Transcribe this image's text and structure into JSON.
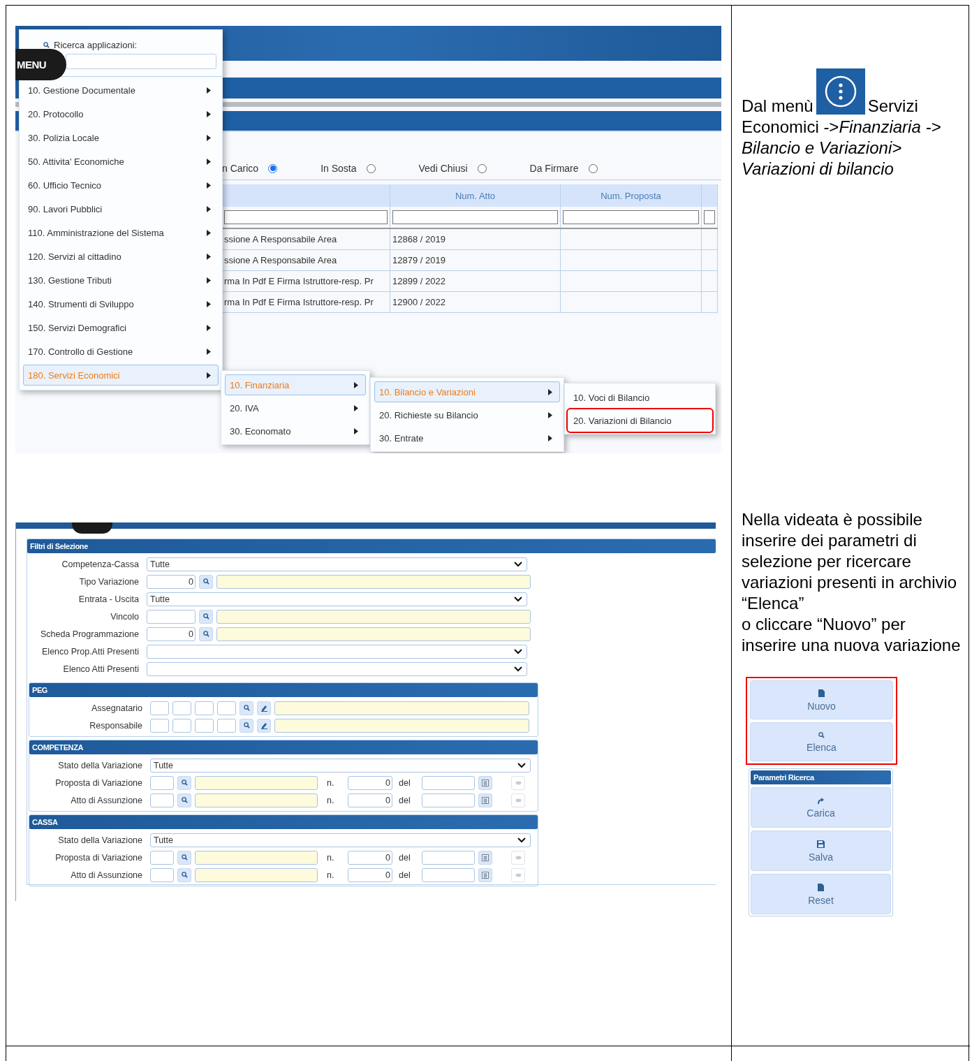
{
  "menu_screenshot": {
    "radios": [
      {
        "label": "n Carico",
        "selected": true
      },
      {
        "label": "In Sosta",
        "selected": false
      },
      {
        "label": "Vedi Chiusi",
        "selected": false
      },
      {
        "label": "Da Firmare",
        "selected": false
      }
    ],
    "table": {
      "columns": [
        "",
        "Num. Atto",
        "Num. Proposta"
      ],
      "rows": [
        [
          "ssione A Responsabile Area",
          "12868 / 2019"
        ],
        [
          "ssione A Responsabile Area",
          "12879 / 2019"
        ],
        [
          "rma In Pdf E Firma Istruttore-resp. Pr",
          "12899 / 2022"
        ],
        [
          "rma In Pdf E Firma Istruttore-resp. Pr",
          "12900 / 2022"
        ]
      ]
    },
    "menu": {
      "badge": "MENU",
      "search_label": "Ricerca applicazioni:",
      "items": [
        {
          "label": "10. Gestione Documentale",
          "selected": false
        },
        {
          "label": "20. Protocollo",
          "selected": false
        },
        {
          "label": "30. Polizia Locale",
          "selected": false
        },
        {
          "label": "50. Attivita' Economiche",
          "selected": false
        },
        {
          "label": "60. Ufficio Tecnico",
          "selected": false
        },
        {
          "label": "90. Lavori Pubblici",
          "selected": false
        },
        {
          "label": "110. Amministrazione del Sistema",
          "selected": false
        },
        {
          "label": "120. Servizi al cittadino",
          "selected": false
        },
        {
          "label": "130. Gestione Tributi",
          "selected": false
        },
        {
          "label": "140. Strumenti di Sviluppo",
          "selected": false
        },
        {
          "label": "150. Servizi Demografici",
          "selected": false
        },
        {
          "label": "170. Controllo di Gestione",
          "selected": false
        },
        {
          "label": "180. Servizi Economici",
          "selected": true
        }
      ]
    },
    "submenus": [
      {
        "items": [
          {
            "label": "10. Finanziaria",
            "selected": true,
            "submenu": true,
            "highlighted": false
          },
          {
            "label": "20. IVA",
            "selected": false,
            "submenu": true,
            "highlighted": false
          },
          {
            "label": "30. Economato",
            "selected": false,
            "submenu": true,
            "highlighted": false
          }
        ]
      },
      {
        "items": [
          {
            "label": "10. Bilancio e Variazioni",
            "selected": true,
            "submenu": true,
            "highlighted": false
          },
          {
            "label": "20. Richieste su Bilancio",
            "selected": false,
            "submenu": true,
            "highlighted": false
          },
          {
            "label": "30. Entrate",
            "selected": false,
            "submenu": true,
            "highlighted": false
          }
        ]
      },
      {
        "items": [
          {
            "label": "10. Voci di Bilancio",
            "selected": false,
            "submenu": false,
            "highlighted": false
          },
          {
            "label": "20. Variazioni di Bilancio",
            "selected": false,
            "submenu": false,
            "highlighted": true
          }
        ]
      }
    ]
  },
  "form_screenshot": {
    "title": "Filtri di Selezione",
    "rows": [
      {
        "label": "Competenza-Cassa",
        "kind": "select",
        "value": "Tutte"
      },
      {
        "label": "Tipo Variazione",
        "kind": "lookup",
        "value": "0"
      },
      {
        "label": "Entrata - Uscita",
        "kind": "select",
        "value": "Tutte"
      },
      {
        "label": "Vincolo",
        "kind": "lookup"
      },
      {
        "label": "Scheda Programmazione",
        "kind": "lookup",
        "value": "0"
      },
      {
        "label": "Elenco Prop.Atti Presenti",
        "kind": "select"
      },
      {
        "label": "Elenco Atti Presenti",
        "kind": "select"
      }
    ],
    "sections": [
      {
        "title": "PEG",
        "rows": [
          {
            "label": "Assegnatario",
            "kind": "peg"
          },
          {
            "label": "Responsabile",
            "kind": "peg"
          }
        ]
      },
      {
        "title": "COMPETENZA",
        "rows": [
          {
            "label": "Stato della Variazione",
            "kind": "select",
            "value": "Tutte"
          },
          {
            "label": "Proposta di Variazione",
            "kind": "atto",
            "number_label": "n.",
            "number": "0",
            "date_label": "del"
          },
          {
            "label": "Atto di Assunzione",
            "kind": "atto",
            "number_label": "n.",
            "number": "0",
            "date_label": "del"
          }
        ]
      },
      {
        "title": "CASSA",
        "rows": [
          {
            "label": "Stato della Variazione",
            "kind": "select",
            "value": "Tutte"
          },
          {
            "label": "Proposta di Variazione",
            "kind": "atto",
            "number_label": "n.",
            "number": "0",
            "date_label": "del"
          },
          {
            "label": "Atto di Assunzione",
            "kind": "atto",
            "number_label": "n.",
            "number": "0",
            "date_label": "del"
          }
        ]
      }
    ]
  },
  "instructions": {
    "intro_before_icon": "Dal menù",
    "intro_after_icon": "Servizi",
    "intro_continued": "Economici ->*Finanziaria -> Bilancio e Variazioni> Variazioni di bilancio*",
    "description": "Nella videata è possibile inserire dei parametri di selezione per ricercare variazioni presenti in archivio\n“Elenca”\no cliccare “Nuovo” per inserire una nuova variazione",
    "actions": {
      "highlighted": true,
      "buttons": [
        {
          "label": "Nuovo"
        },
        {
          "label": "Elenca"
        }
      ]
    },
    "panel": {
      "title": "Parametri Ricerca",
      "buttons": [
        {
          "label": "Carica"
        },
        {
          "label": "Salva"
        },
        {
          "label": "Reset"
        }
      ]
    }
  }
}
